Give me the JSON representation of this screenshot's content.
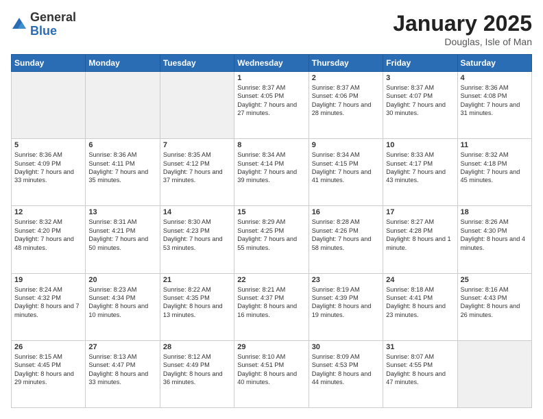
{
  "logo": {
    "general": "General",
    "blue": "Blue"
  },
  "title": "January 2025",
  "subtitle": "Douglas, Isle of Man",
  "days_header": [
    "Sunday",
    "Monday",
    "Tuesday",
    "Wednesday",
    "Thursday",
    "Friday",
    "Saturday"
  ],
  "weeks": [
    [
      {
        "day": "",
        "content": ""
      },
      {
        "day": "",
        "content": ""
      },
      {
        "day": "",
        "content": ""
      },
      {
        "day": "1",
        "content": "Sunrise: 8:37 AM\nSunset: 4:05 PM\nDaylight: 7 hours and 27 minutes."
      },
      {
        "day": "2",
        "content": "Sunrise: 8:37 AM\nSunset: 4:06 PM\nDaylight: 7 hours and 28 minutes."
      },
      {
        "day": "3",
        "content": "Sunrise: 8:37 AM\nSunset: 4:07 PM\nDaylight: 7 hours and 30 minutes."
      },
      {
        "day": "4",
        "content": "Sunrise: 8:36 AM\nSunset: 4:08 PM\nDaylight: 7 hours and 31 minutes."
      }
    ],
    [
      {
        "day": "5",
        "content": "Sunrise: 8:36 AM\nSunset: 4:09 PM\nDaylight: 7 hours and 33 minutes."
      },
      {
        "day": "6",
        "content": "Sunrise: 8:36 AM\nSunset: 4:11 PM\nDaylight: 7 hours and 35 minutes."
      },
      {
        "day": "7",
        "content": "Sunrise: 8:35 AM\nSunset: 4:12 PM\nDaylight: 7 hours and 37 minutes."
      },
      {
        "day": "8",
        "content": "Sunrise: 8:34 AM\nSunset: 4:14 PM\nDaylight: 7 hours and 39 minutes."
      },
      {
        "day": "9",
        "content": "Sunrise: 8:34 AM\nSunset: 4:15 PM\nDaylight: 7 hours and 41 minutes."
      },
      {
        "day": "10",
        "content": "Sunrise: 8:33 AM\nSunset: 4:17 PM\nDaylight: 7 hours and 43 minutes."
      },
      {
        "day": "11",
        "content": "Sunrise: 8:32 AM\nSunset: 4:18 PM\nDaylight: 7 hours and 45 minutes."
      }
    ],
    [
      {
        "day": "12",
        "content": "Sunrise: 8:32 AM\nSunset: 4:20 PM\nDaylight: 7 hours and 48 minutes."
      },
      {
        "day": "13",
        "content": "Sunrise: 8:31 AM\nSunset: 4:21 PM\nDaylight: 7 hours and 50 minutes."
      },
      {
        "day": "14",
        "content": "Sunrise: 8:30 AM\nSunset: 4:23 PM\nDaylight: 7 hours and 53 minutes."
      },
      {
        "day": "15",
        "content": "Sunrise: 8:29 AM\nSunset: 4:25 PM\nDaylight: 7 hours and 55 minutes."
      },
      {
        "day": "16",
        "content": "Sunrise: 8:28 AM\nSunset: 4:26 PM\nDaylight: 7 hours and 58 minutes."
      },
      {
        "day": "17",
        "content": "Sunrise: 8:27 AM\nSunset: 4:28 PM\nDaylight: 8 hours and 1 minute."
      },
      {
        "day": "18",
        "content": "Sunrise: 8:26 AM\nSunset: 4:30 PM\nDaylight: 8 hours and 4 minutes."
      }
    ],
    [
      {
        "day": "19",
        "content": "Sunrise: 8:24 AM\nSunset: 4:32 PM\nDaylight: 8 hours and 7 minutes."
      },
      {
        "day": "20",
        "content": "Sunrise: 8:23 AM\nSunset: 4:34 PM\nDaylight: 8 hours and 10 minutes."
      },
      {
        "day": "21",
        "content": "Sunrise: 8:22 AM\nSunset: 4:35 PM\nDaylight: 8 hours and 13 minutes."
      },
      {
        "day": "22",
        "content": "Sunrise: 8:21 AM\nSunset: 4:37 PM\nDaylight: 8 hours and 16 minutes."
      },
      {
        "day": "23",
        "content": "Sunrise: 8:19 AM\nSunset: 4:39 PM\nDaylight: 8 hours and 19 minutes."
      },
      {
        "day": "24",
        "content": "Sunrise: 8:18 AM\nSunset: 4:41 PM\nDaylight: 8 hours and 23 minutes."
      },
      {
        "day": "25",
        "content": "Sunrise: 8:16 AM\nSunset: 4:43 PM\nDaylight: 8 hours and 26 minutes."
      }
    ],
    [
      {
        "day": "26",
        "content": "Sunrise: 8:15 AM\nSunset: 4:45 PM\nDaylight: 8 hours and 29 minutes."
      },
      {
        "day": "27",
        "content": "Sunrise: 8:13 AM\nSunset: 4:47 PM\nDaylight: 8 hours and 33 minutes."
      },
      {
        "day": "28",
        "content": "Sunrise: 8:12 AM\nSunset: 4:49 PM\nDaylight: 8 hours and 36 minutes."
      },
      {
        "day": "29",
        "content": "Sunrise: 8:10 AM\nSunset: 4:51 PM\nDaylight: 8 hours and 40 minutes."
      },
      {
        "day": "30",
        "content": "Sunrise: 8:09 AM\nSunset: 4:53 PM\nDaylight: 8 hours and 44 minutes."
      },
      {
        "day": "31",
        "content": "Sunrise: 8:07 AM\nSunset: 4:55 PM\nDaylight: 8 hours and 47 minutes."
      },
      {
        "day": "",
        "content": ""
      }
    ]
  ]
}
